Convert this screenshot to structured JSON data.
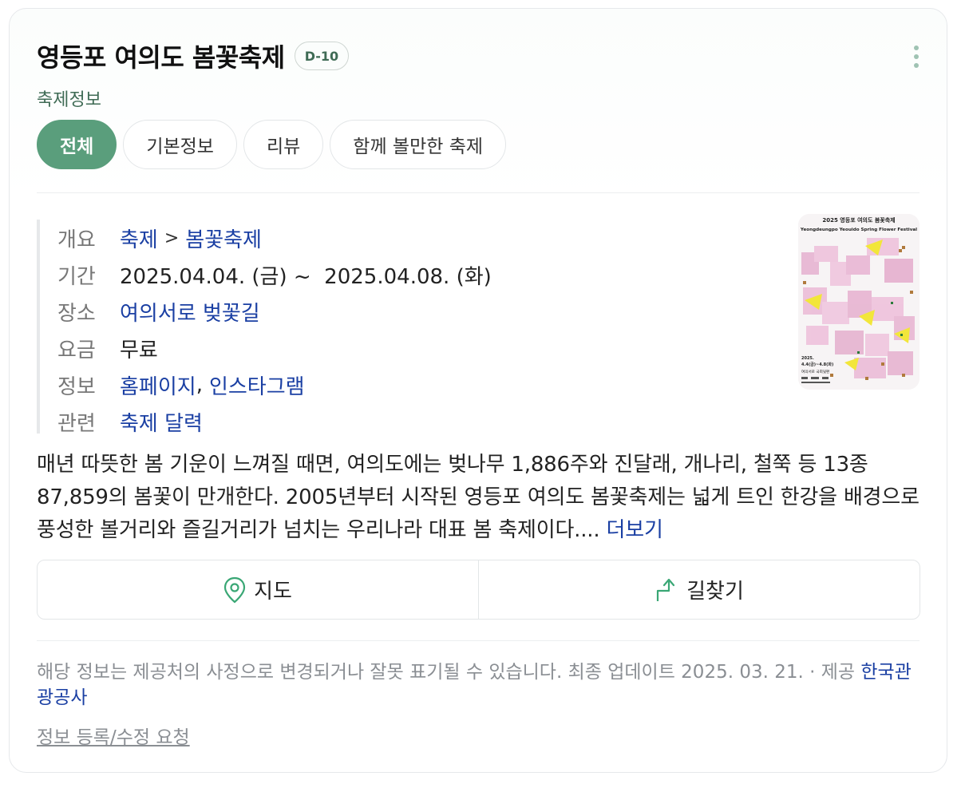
{
  "header": {
    "title": "영등포 여의도 봄꽃축제",
    "dday_badge": "D-10",
    "subtitle": "축제정보"
  },
  "tabs": [
    {
      "label": "전체",
      "active": true
    },
    {
      "label": "기본정보",
      "active": false
    },
    {
      "label": "리뷰",
      "active": false
    },
    {
      "label": "함께 볼만한 축제",
      "active": false
    }
  ],
  "info": {
    "overview": {
      "label": "개요",
      "category": "축제",
      "separator": ">",
      "subcategory": "봄꽃축제"
    },
    "period": {
      "label": "기간",
      "value": "2025.04.04. (금) ~  2025.04.08. (화)"
    },
    "place": {
      "label": "장소",
      "value": "여의서로 벚꽃길"
    },
    "fee": {
      "label": "요금",
      "value": "무료"
    },
    "links": {
      "label": "정보",
      "homepage": "홈페이지",
      "comma": ",",
      "instagram": "인스타그램"
    },
    "related": {
      "label": "관련",
      "value": "축제 달력"
    }
  },
  "poster": {
    "year_title": "2025 영등포 여의도 봄꽃축제",
    "english": "Yeongdeungpo Yeouido Spring Flower Festival",
    "date_text": "4.4(금)~4.8(화)",
    "place_text": "여의서로 국회뒷편"
  },
  "description": {
    "text": "매년 따뜻한 봄 기운이 느껴질 때면, 여의도에는 벚나무 1,886주와 진달래, 개나리, 철쭉 등 13종 87,859의 봄꽃이 만개한다. 2005년부터 시작된 영등포 여의도 봄꽃축제는 넓게 트인 한강을 배경으로 풍성한 볼거리와 즐길거리가 넘치는 우리나라 대표 봄 축제이다....",
    "more_label": "더보기"
  },
  "actions": {
    "map_label": "지도",
    "directions_label": "길찾기"
  },
  "footer": {
    "notice": "해당 정보는 제공처의 사정으로 변경되거나 잘못 표기될 수 있습니다. 최종 업데이트 2025. 03. 21.",
    "provider_prefix": "· 제공",
    "provider": "한국관광공사",
    "report_label": "정보 등록/수정 요청"
  },
  "colors": {
    "accent_green": "#5a9e7c",
    "link_blue": "#1a3fa3",
    "muted_green": "#3f6b55"
  }
}
